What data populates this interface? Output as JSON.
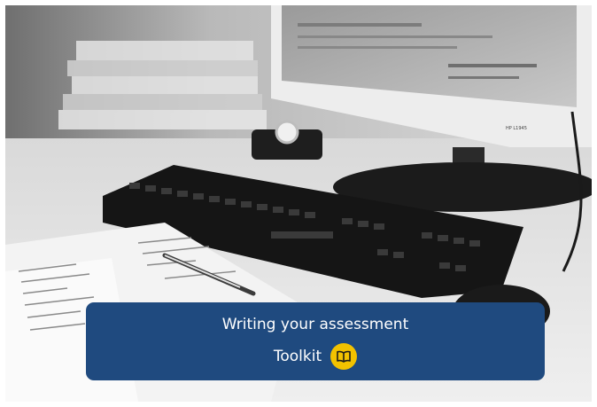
{
  "banner": {
    "title": "Writing your assessment",
    "subtitle": "Toolkit",
    "icon": "open-book-icon",
    "background_color": "#1f4a7f",
    "badge_color": "#f2c200"
  },
  "photo": {
    "subject": "monochrome desk with computer monitor, keyboard, pen and printed documents",
    "monitor_label": "HP L1945"
  }
}
